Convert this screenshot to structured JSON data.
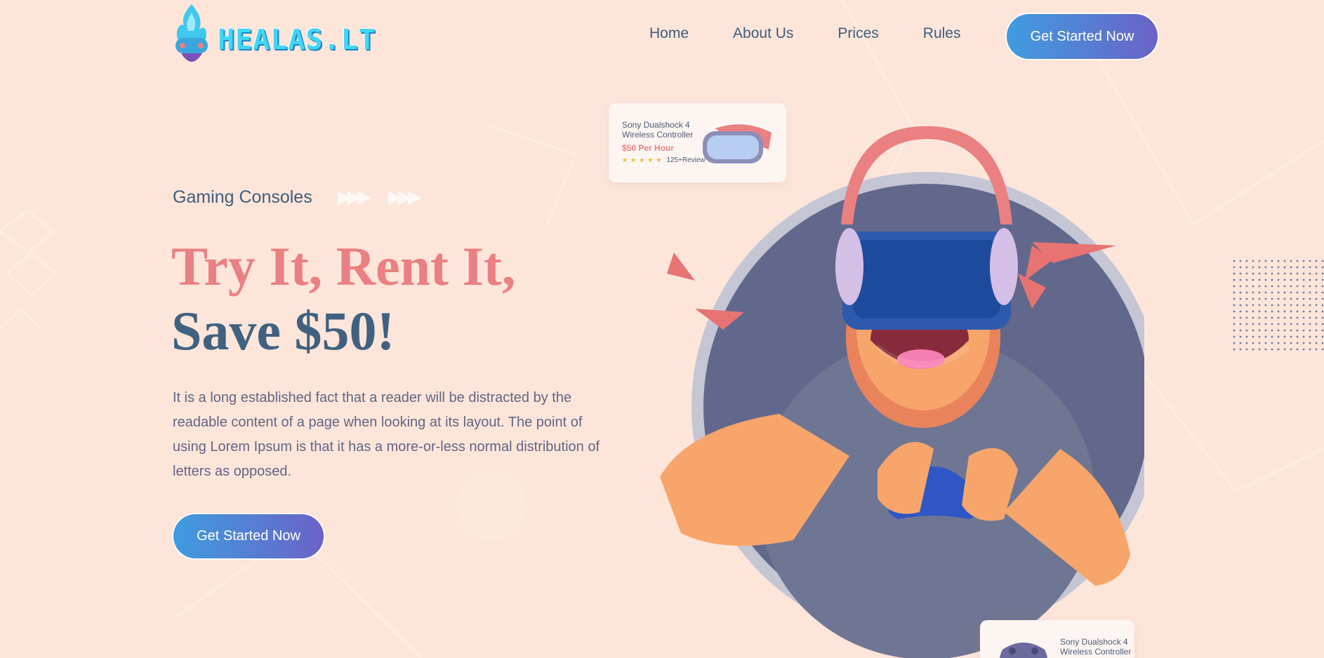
{
  "brand": {
    "logo_text": "HEALAS.LT"
  },
  "nav": {
    "items": [
      {
        "label": "Home"
      },
      {
        "label": "About Us"
      },
      {
        "label": "Prices"
      },
      {
        "label": "Rules"
      }
    ],
    "cta_label": "Get Started Now"
  },
  "hero": {
    "eyebrow": "Gaming Consoles",
    "headline_line1": "Try It, Rent It,",
    "headline_line2": "Save $50!",
    "description": "It is a long established fact that a reader will be distracted by the readable content of a page when looking at its layout. The point of using Lorem Ipsum is that it has a more-or-less normal distribution of letters as opposed.",
    "cta_label": "Get Started Now"
  },
  "cards": [
    {
      "title": "Sony Dualshock 4 Wireless Controller",
      "price": "$50 Per Hour",
      "stars": 5,
      "reviews": "125+Review",
      "icon": "vr-headset-icon"
    },
    {
      "title": "Sony Dualshock 4 Wireless Controller",
      "icon": "gamepad-icon"
    }
  ],
  "colors": {
    "background": "#fde5da",
    "accent_coral": "#ea8081",
    "navy": "#40617f",
    "button_gradient_start": "#3f9ce0",
    "button_gradient_end": "#6a63c5",
    "star": "#f4b23a"
  }
}
